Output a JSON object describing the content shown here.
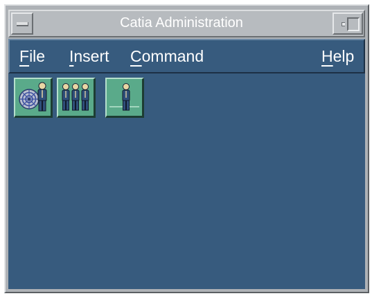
{
  "window": {
    "title": "Catia Administration"
  },
  "menubar": {
    "file": {
      "mnemonic": "F",
      "rest": "ile"
    },
    "insert": {
      "mnemonic": "I",
      "rest": "nsert"
    },
    "command": {
      "mnemonic": "C",
      "rest": "ommand"
    },
    "help": {
      "mnemonic": "H",
      "rest": "elp"
    }
  },
  "toolbar": {
    "buttons": [
      {
        "icon": "network-administrator-icon"
      },
      {
        "icon": "user-group-icon"
      },
      {
        "icon": "single-user-icon"
      }
    ]
  },
  "colors": {
    "client_background": "#375b7e",
    "window_frame": "#aeb2b6",
    "toolbar_button": "#5aaa8a",
    "figure_body": "#2f4f7a",
    "figure_head": "#e8d6a4"
  }
}
